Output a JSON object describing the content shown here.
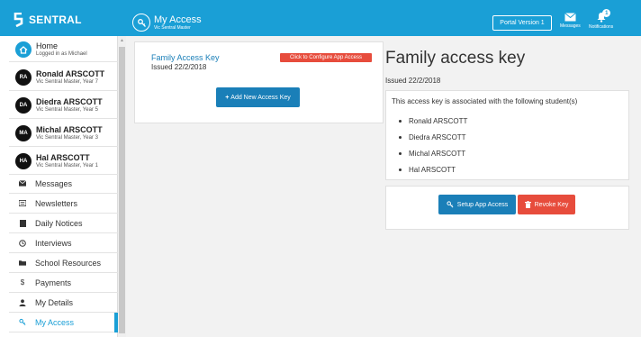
{
  "header": {
    "brand": "SENTRAL",
    "page_title": "My Access",
    "page_subtitle": "Vic Sentral Master",
    "portal_version": "Portal Version 1",
    "messages_label": "Messages",
    "notifications_label": "Notifications",
    "notifications_count": "1"
  },
  "sidebar": {
    "home": {
      "label": "Home",
      "sub": "Logged in as Michael"
    },
    "students": [
      {
        "initials": "RA",
        "name": "Ronald ARSCOTT",
        "sub": "Vic Sentral Master, Year 7"
      },
      {
        "initials": "DA",
        "name": "Diedra ARSCOTT",
        "sub": "Vic Sentral Master, Year 5"
      },
      {
        "initials": "MA",
        "name": "Michal ARSCOTT",
        "sub": "Vic Sentral Master, Year 3"
      },
      {
        "initials": "HA",
        "name": "Hal ARSCOTT",
        "sub": "Vic Sentral Master, Year 1"
      }
    ],
    "menu": [
      {
        "label": "Messages",
        "icon": "envelope-icon"
      },
      {
        "label": "Newsletters",
        "icon": "newspaper-icon"
      },
      {
        "label": "Daily Notices",
        "icon": "notice-icon"
      },
      {
        "label": "Interviews",
        "icon": "clock-icon"
      },
      {
        "label": "School Resources",
        "icon": "folder-icon"
      },
      {
        "label": "Payments",
        "icon": "dollar-icon"
      },
      {
        "label": "My Details",
        "icon": "user-icon"
      },
      {
        "label": "My Access",
        "icon": "key-icon"
      }
    ]
  },
  "key_card": {
    "title": "Family Access Key",
    "issued": "Issued 22/2/2018",
    "configure_badge": "Click to Configure App Access",
    "add_button": "Add New Access Key"
  },
  "detail": {
    "title": "Family access key",
    "issued": "Issued 22/2/2018",
    "associated_text": "This access key is associated with the following student(s)",
    "students": [
      "Ronald ARSCOTT",
      "Diedra ARSCOTT",
      "Michal ARSCOTT",
      "Hal ARSCOTT"
    ],
    "setup_button": "Setup App Access",
    "revoke_button": "Revoke Key"
  },
  "colors": {
    "accent": "#1a9fd6",
    "button_primary": "#1a7fb8",
    "danger": "#e74c3c"
  }
}
